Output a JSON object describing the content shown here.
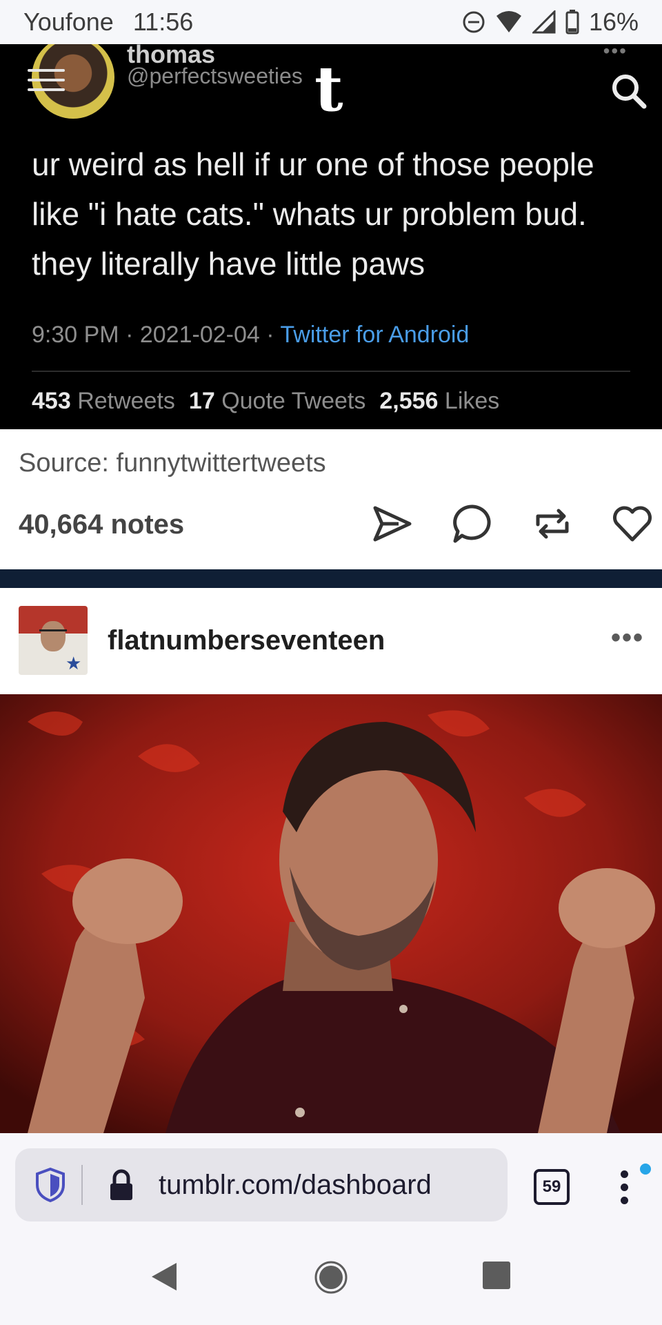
{
  "status_bar": {
    "carrier": "Youfone",
    "time": "11:56",
    "battery": "16%"
  },
  "tweet": {
    "name": "thomas",
    "handle": "@perfectsweeties",
    "text_lines": [
      "ur weird as hell if ur one of those people",
      "like \"i hate cats.\" whats ur problem bud.",
      "they literally have little paws"
    ],
    "time": "9:30 PM",
    "date": "2021-02-04",
    "app": "Twitter for Android",
    "retweets_count": "453",
    "retweets_label": "Retweets",
    "quotes_count": "17",
    "quotes_label": "Quote Tweets",
    "likes_count": "2,556",
    "likes_label": "Likes"
  },
  "tumblr_header": {
    "logo": "t"
  },
  "post1": {
    "source": "Source: funnytwittertweets",
    "notes": "40,664 notes"
  },
  "post2": {
    "blog_name": "flatnumberseventeen"
  },
  "browser": {
    "url": "tumblr.com/dashboard",
    "tab_count": "59"
  },
  "colors": {
    "link_blue": "#4a9de8",
    "navy": "#0f1f35",
    "notif": "#27a5e8"
  }
}
